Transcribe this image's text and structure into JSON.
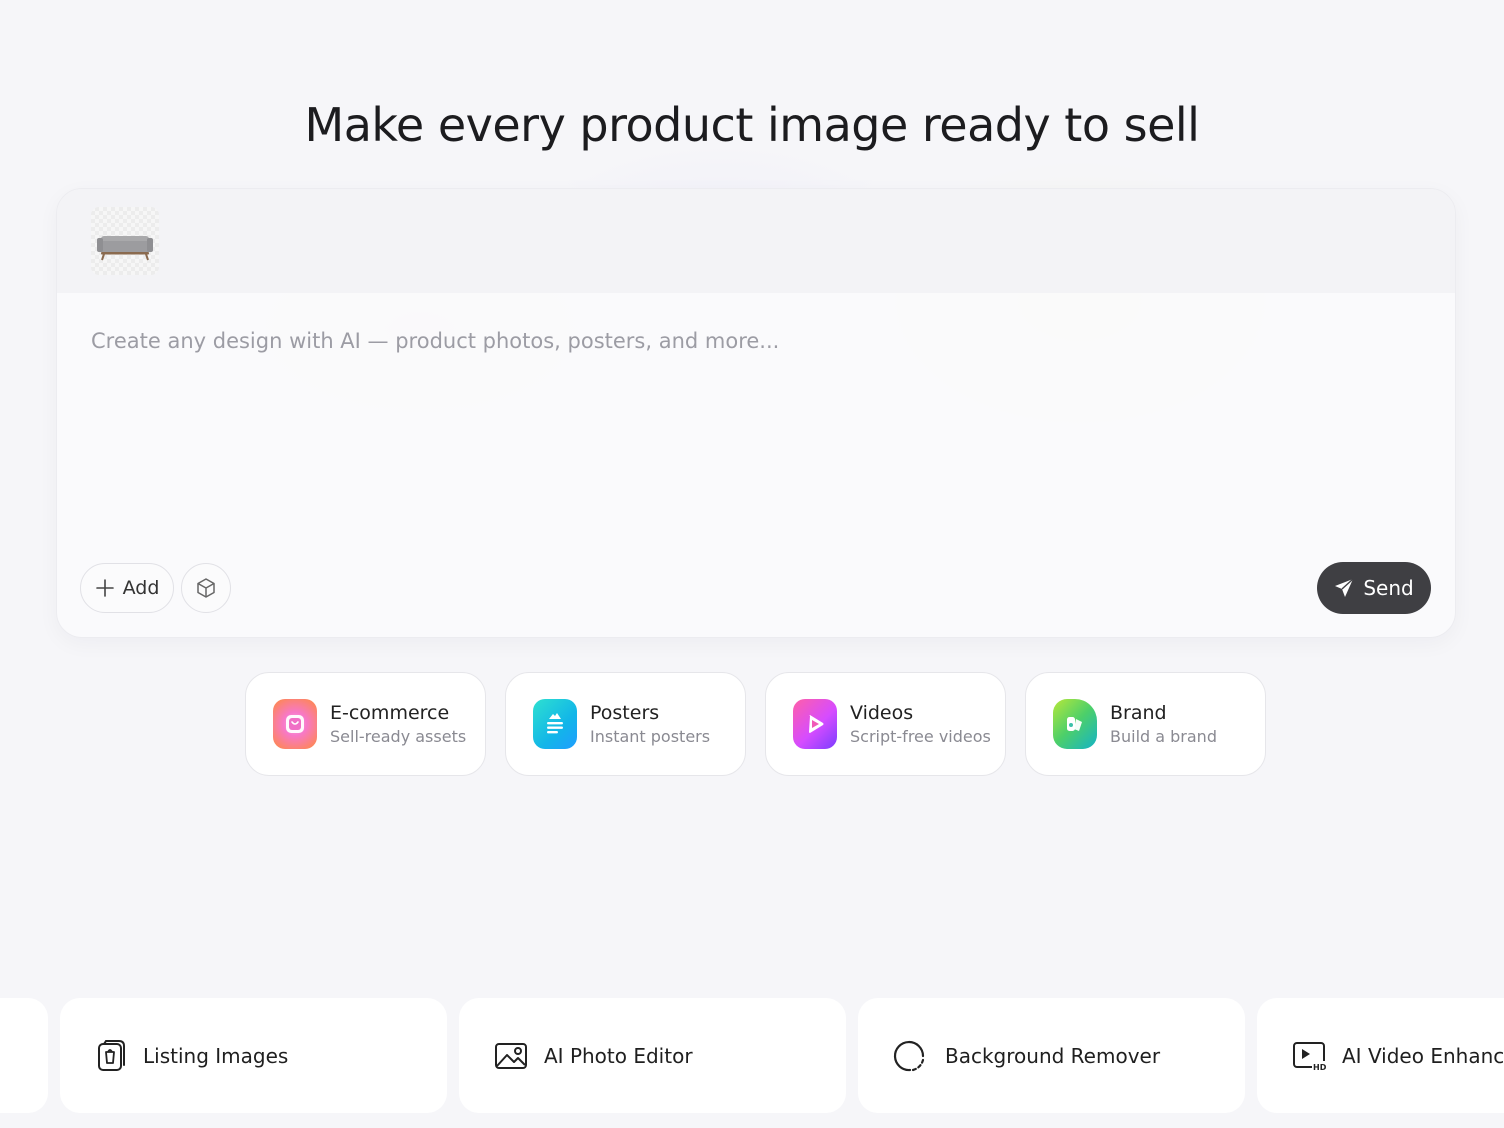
{
  "page": {
    "headline": "Make every product image ready to sell"
  },
  "composer": {
    "attachment": {
      "thumbnail_icon": "sofa-icon"
    },
    "prompt_placeholder": "Create any design with AI — product photos, posters, and more...",
    "prompt_value": "",
    "add_label": "Add",
    "add_icon": "plus-icon",
    "model_icon": "cube-icon",
    "send_label": "Send",
    "send_icon": "paper-plane-icon",
    "send_color": "#3f3f43"
  },
  "categories": [
    {
      "title": "E-commerce",
      "subtitle": "Sell-ready assets",
      "icon": "shopping-bag-icon",
      "color_from": "#ff7a4a",
      "color_to": "#d755ff"
    },
    {
      "title": "Posters",
      "subtitle": "Instant posters",
      "icon": "poster-icon",
      "color_from": "#22d3c5",
      "color_to": "#1f9dff"
    },
    {
      "title": "Videos",
      "subtitle": "Script-free videos",
      "icon": "play-icon",
      "color_from": "#ff4fa1",
      "color_to": "#8b3dff"
    },
    {
      "title": "Brand",
      "subtitle": "Build a brand",
      "icon": "brand-icon",
      "color_from": "#a3e635",
      "color_to": "#10b0c8"
    }
  ],
  "tools": [
    {
      "label": "",
      "icon": ""
    },
    {
      "label": "Listing Images",
      "icon": "listing-images-icon"
    },
    {
      "label": "AI Photo Editor",
      "icon": "photo-editor-icon"
    },
    {
      "label": "Background Remover",
      "icon": "background-remover-icon"
    },
    {
      "label": "AI Video Enhancer",
      "icon": "video-enhancer-icon"
    }
  ]
}
